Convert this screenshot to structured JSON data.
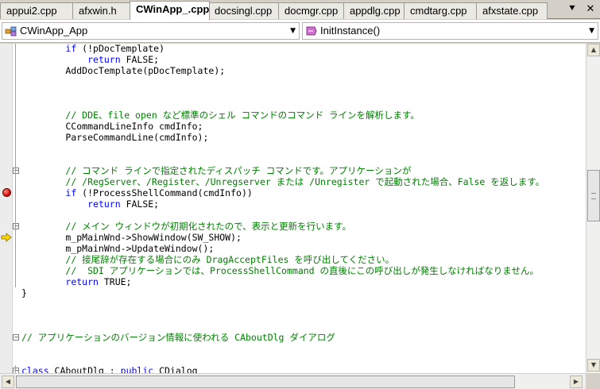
{
  "tabs": [
    {
      "label": "appui2.cpp",
      "active": false
    },
    {
      "label": "afxwin.h",
      "active": false
    },
    {
      "label": "CWinApp_.cpp",
      "active": true
    },
    {
      "label": "docsingl.cpp",
      "active": false
    },
    {
      "label": "docmgr.cpp",
      "active": false
    },
    {
      "label": "appdlg.cpp",
      "active": false
    },
    {
      "label": "cmdtarg.cpp",
      "active": false
    },
    {
      "label": "afxstate.cpp",
      "active": false
    }
  ],
  "tab_controls": {
    "dropdown": "⯆",
    "close": "✕"
  },
  "navigation": {
    "class_combo": {
      "value": "CWinApp_App",
      "icon": "class-icon"
    },
    "member_combo": {
      "value": "InitInstance()",
      "icon": "method-icon"
    }
  },
  "code_lines": [
    {
      "parts": [
        {
          "t": "        "
        },
        {
          "t": "if",
          "c": "kw"
        },
        {
          "t": " (!pDocTemplate)"
        }
      ]
    },
    {
      "parts": [
        {
          "t": "            "
        },
        {
          "t": "return",
          "c": "kw"
        },
        {
          "t": " FALSE;"
        }
      ]
    },
    {
      "parts": [
        {
          "t": "        AddDocTemplate(pDocTemplate);"
        }
      ]
    },
    {
      "parts": []
    },
    {
      "parts": []
    },
    {
      "parts": []
    },
    {
      "parts": [
        {
          "t": "        "
        },
        {
          "t": "// DDE、file open など標準のシェル コマンドのコマンド ラインを解析します。",
          "c": "cm"
        }
      ]
    },
    {
      "parts": [
        {
          "t": "        CCommandLineInfo cmdInfo;"
        }
      ]
    },
    {
      "parts": [
        {
          "t": "        ParseCommandLine(cmdInfo);"
        }
      ]
    },
    {
      "parts": []
    },
    {
      "parts": []
    },
    {
      "parts": [
        {
          "t": "        "
        },
        {
          "t": "// コマンド ラインで指定されたディスパッチ コマンドです。アプリケーションが",
          "c": "cm"
        }
      ]
    },
    {
      "parts": [
        {
          "t": "        "
        },
        {
          "t": "// /RegServer、/Register、/Unregserver または /Unregister で起動された場合、False を返します。",
          "c": "cm"
        }
      ]
    },
    {
      "parts": [
        {
          "t": "        "
        },
        {
          "t": "if",
          "c": "kw"
        },
        {
          "t": " (!ProcessShellCommand(cmdInfo))"
        }
      ]
    },
    {
      "parts": [
        {
          "t": "            "
        },
        {
          "t": "return",
          "c": "kw"
        },
        {
          "t": " FALSE;"
        }
      ]
    },
    {
      "parts": []
    },
    {
      "parts": [
        {
          "t": "        "
        },
        {
          "t": "// メイン ウィンドウが初期化されたので、表示と更新を行います。",
          "c": "cm"
        }
      ]
    },
    {
      "parts": [
        {
          "t": "        m_pMainWnd->ShowWindow(SW_SHOW);"
        }
      ]
    },
    {
      "parts": [
        {
          "t": "        m_pMainWnd->UpdateWindow();"
        }
      ]
    },
    {
      "parts": [
        {
          "t": "        "
        },
        {
          "t": "// 接尾辞が存在する場合にのみ DragAcceptFiles を呼び出してください。",
          "c": "cm"
        }
      ]
    },
    {
      "parts": [
        {
          "t": "        "
        },
        {
          "t": "//  SDI アプリケーションでは、ProcessShellCommand の直後にこの呼び出しが発生しなければなりません。",
          "c": "cm"
        }
      ]
    },
    {
      "parts": [
        {
          "t": "        "
        },
        {
          "t": "return",
          "c": "kw"
        },
        {
          "t": " TRUE;"
        }
      ]
    },
    {
      "parts": [
        {
          "t": "}"
        }
      ]
    },
    {
      "parts": []
    },
    {
      "parts": []
    },
    {
      "parts": []
    },
    {
      "parts": [
        {
          "t": "// アプリケーションのバージョン情報に使われる CAboutDlg ダイアログ",
          "c": "cm"
        }
      ]
    },
    {
      "parts": []
    },
    {
      "parts": []
    },
    {
      "parts": [
        {
          "t": "class",
          "c": "kw"
        },
        {
          "t": " CAboutDlg : "
        },
        {
          "t": "public",
          "c": "kw"
        },
        {
          "t": " CDialog"
        }
      ]
    },
    {
      "parts": [
        {
          "t": "{"
        }
      ]
    }
  ],
  "colors": {
    "keyword": "#0000ff",
    "comment": "#008000",
    "text": "#000000",
    "breakpoint": "#c40000",
    "exec_arrow": "#ffd800"
  },
  "markers": {
    "breakpoint_line": 13,
    "current_line": 17
  },
  "fold_markers": [
    11,
    16,
    26,
    29
  ],
  "scrollbar": {
    "vertical_position": 0.45
  }
}
